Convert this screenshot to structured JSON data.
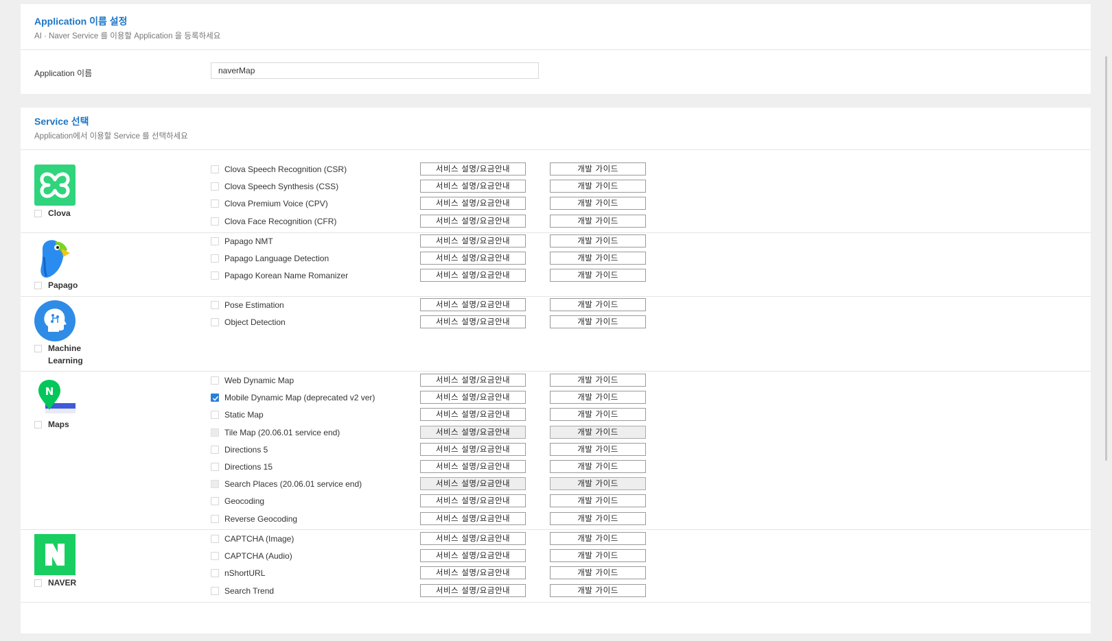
{
  "app_section": {
    "title": "Application 이름 설정",
    "subtitle": "AI · Naver Service 를 이용할 Application 을 등록하세요",
    "field_label": "Application 이름",
    "field_value": "naverMap"
  },
  "service_section": {
    "title": "Service 선택",
    "subtitle": "Application에서 이용할 Service 를 선택하세요"
  },
  "buttons": {
    "info_label": "서비스 설명/요금안내",
    "guide_label": "개발 가이드"
  },
  "groups": {
    "clova": {
      "label": "Clova",
      "icon": "clova-icon",
      "color": "#2fd47c",
      "services": [
        {
          "name": "Clova Speech Recognition (CSR)",
          "checked": false,
          "disabled": false
        },
        {
          "name": "Clova Speech Synthesis (CSS)",
          "checked": false,
          "disabled": false
        },
        {
          "name": "Clova Premium Voice (CPV)",
          "checked": false,
          "disabled": false
        },
        {
          "name": "Clova Face Recognition (CFR)",
          "checked": false,
          "disabled": false
        }
      ]
    },
    "papago": {
      "label": "Papago",
      "icon": "papago-parrot-icon",
      "color": "#2a8cf0",
      "services": [
        {
          "name": "Papago NMT",
          "checked": false,
          "disabled": false
        },
        {
          "name": "Papago Language Detection",
          "checked": false,
          "disabled": false
        },
        {
          "name": "Papago Korean Name Romanizer",
          "checked": false,
          "disabled": false
        }
      ]
    },
    "ml": {
      "label_line1": "Machine",
      "label_line2": "Learning",
      "icon": "machine-learning-head-icon",
      "color": "#2f8ce6",
      "services": [
        {
          "name": "Pose Estimation",
          "checked": false,
          "disabled": false
        },
        {
          "name": "Object Detection",
          "checked": false,
          "disabled": false
        }
      ]
    },
    "maps": {
      "label": "Maps",
      "icon": "maps-pin-icon",
      "color": "#03c75a",
      "services": [
        {
          "name": "Web Dynamic Map",
          "checked": false,
          "disabled": false
        },
        {
          "name": "Mobile Dynamic Map (deprecated v2 ver)",
          "checked": true,
          "disabled": false
        },
        {
          "name": "Static Map",
          "checked": false,
          "disabled": false
        },
        {
          "name": "Tile Map (20.06.01 service end)",
          "checked": false,
          "disabled": true
        },
        {
          "name": "Directions 5",
          "checked": false,
          "disabled": false
        },
        {
          "name": "Directions 15",
          "checked": false,
          "disabled": false
        },
        {
          "name": "Search Places (20.06.01 service end)",
          "checked": false,
          "disabled": true
        },
        {
          "name": "Geocoding",
          "checked": false,
          "disabled": false
        },
        {
          "name": "Reverse Geocoding",
          "checked": false,
          "disabled": false
        }
      ]
    },
    "naver": {
      "label": "NAVER",
      "icon": "naver-n-icon",
      "color": "#19ce60",
      "services": [
        {
          "name": "CAPTCHA (Image)",
          "checked": false,
          "disabled": false
        },
        {
          "name": "CAPTCHA (Audio)",
          "checked": false,
          "disabled": false
        },
        {
          "name": "nShortURL",
          "checked": false,
          "disabled": false
        },
        {
          "name": "Search Trend",
          "checked": false,
          "disabled": false
        }
      ]
    }
  }
}
